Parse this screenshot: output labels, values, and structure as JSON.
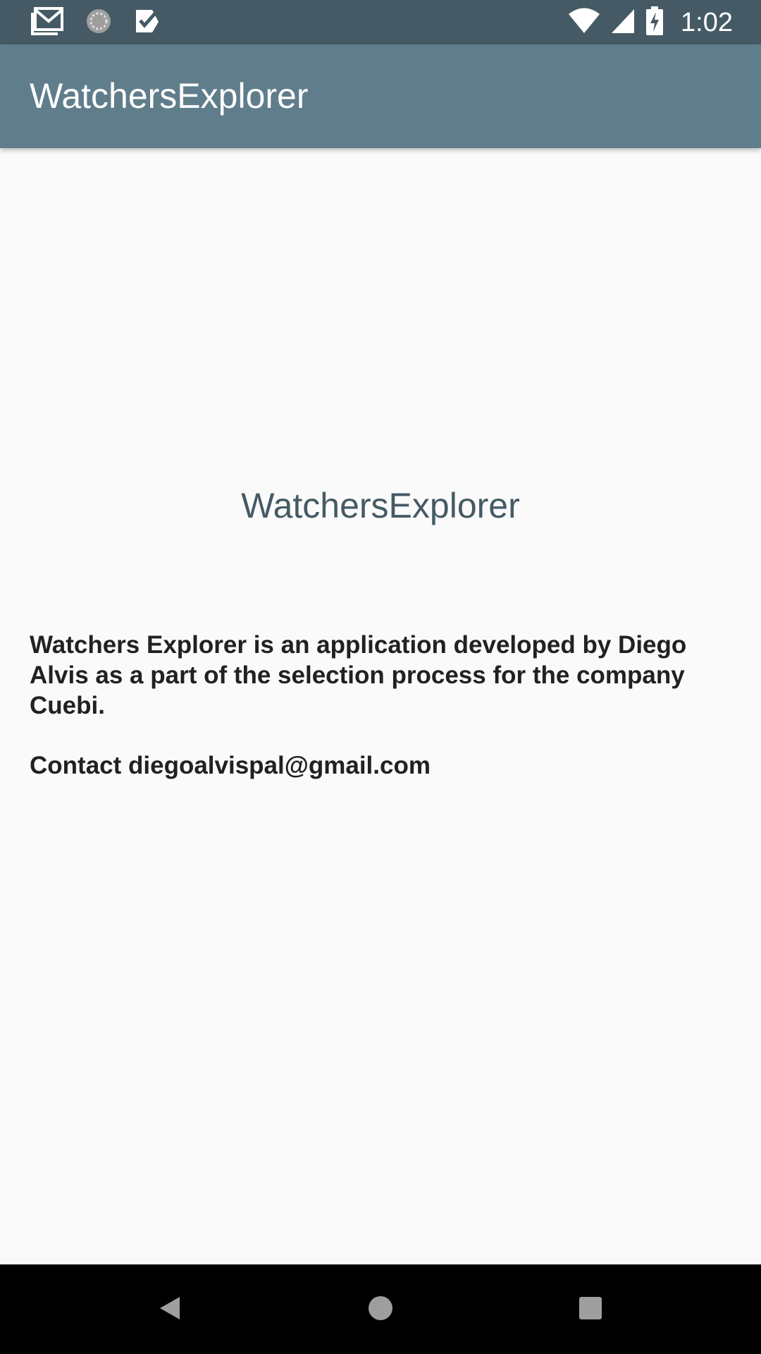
{
  "status_bar": {
    "time": "1:02",
    "notification_icons": [
      "gmail-icon",
      "sync-icon",
      "checkmark-icon"
    ],
    "system_icons": [
      "wifi-icon",
      "cell-signal-icon",
      "battery-charging-icon"
    ]
  },
  "app_bar": {
    "title": "WatchersExplorer"
  },
  "main": {
    "title": "WatchersExplorer",
    "description": "Watchers Explorer is an application developed by Diego Alvis as a part of the selection process for the company Cuebi.",
    "contact": "Contact diegoalvispal@gmail.com"
  },
  "nav_bar": {
    "buttons": [
      "back-icon",
      "home-icon",
      "recents-icon"
    ]
  },
  "colors": {
    "status_bar": "#455a64",
    "app_bar": "#607d8b",
    "title_text": "#455a64",
    "body_text": "#212121",
    "background": "#fafafa"
  }
}
